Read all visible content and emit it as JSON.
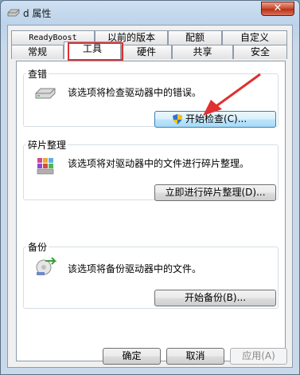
{
  "window": {
    "title": "d 属性",
    "close_label": "✕"
  },
  "tabs": {
    "row1": [
      "ReadyBoost",
      "以前的版本",
      "配额",
      "自定义"
    ],
    "row2": [
      "常规",
      "工具",
      "硬件",
      "共享",
      "安全"
    ],
    "active": "工具"
  },
  "groups": [
    {
      "label": "查错",
      "description": "该选项将检查驱动器中的错误。",
      "button": "开始检查(C)...",
      "icon": "drive-check-icon"
    },
    {
      "label": "碎片整理",
      "description": "该选项将对驱动器中的文件进行碎片整理。",
      "button": "立即进行碎片整理(D)...",
      "icon": "defrag-icon"
    },
    {
      "label": "备份",
      "description": "该选项将备份驱动器中的文件。",
      "button": "开始备份(B)...",
      "icon": "backup-icon"
    }
  ],
  "footer": {
    "ok": "确定",
    "cancel": "取消",
    "apply": "应用(A)"
  },
  "colors": {
    "highlight_outline": "#e03030",
    "annotation_arrow": "#e03030"
  }
}
